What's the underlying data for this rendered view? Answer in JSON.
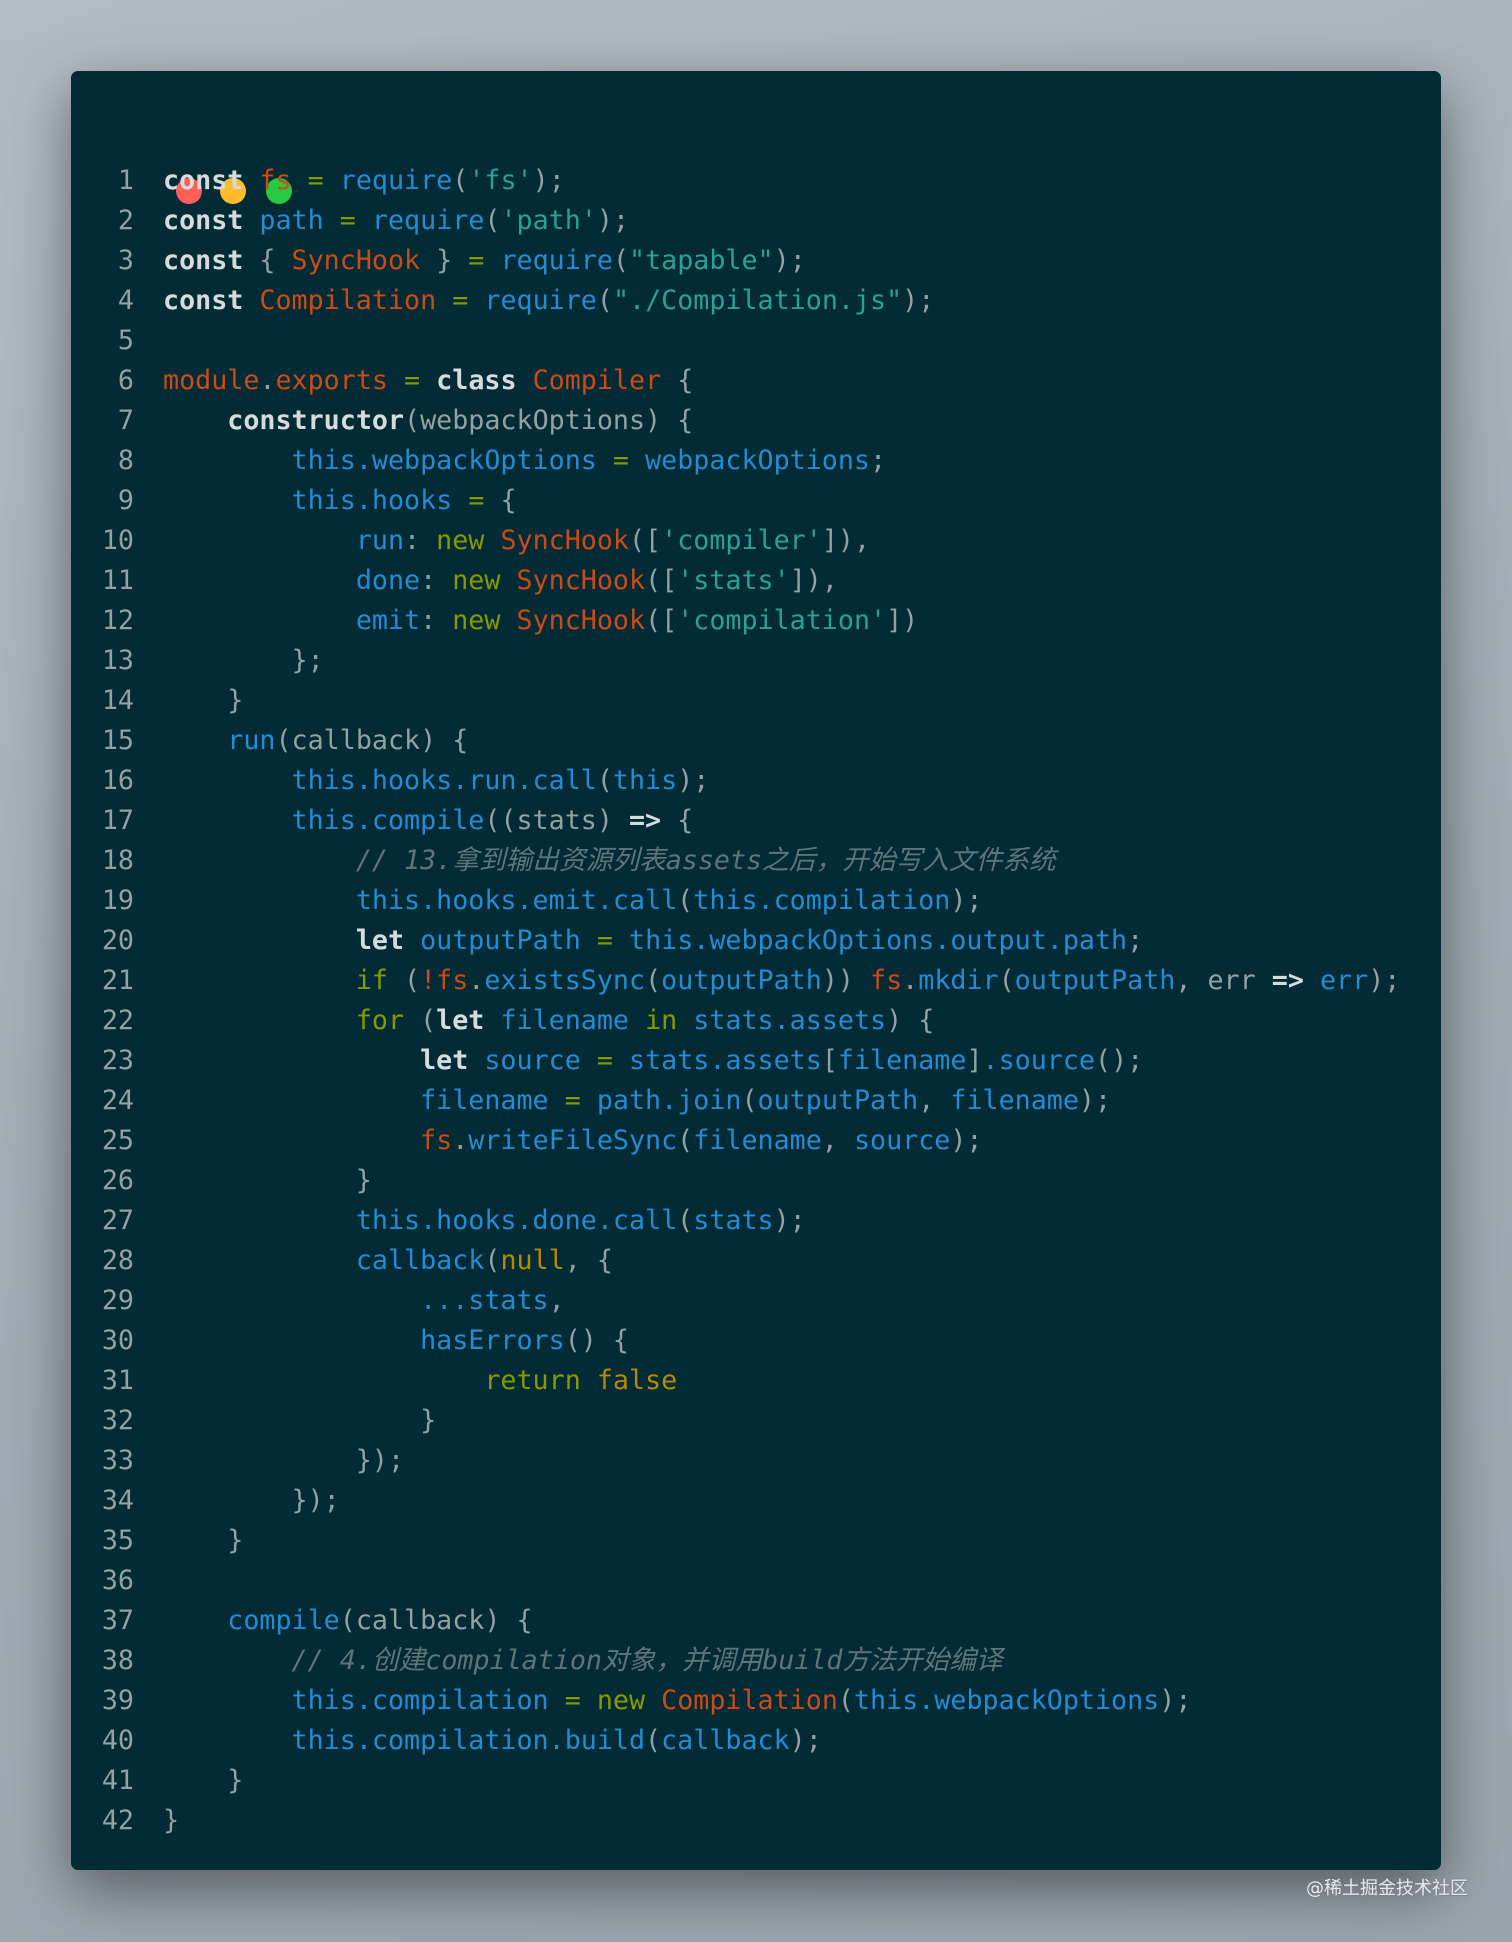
{
  "window": {
    "traffic_lights": {
      "close": "#ff5f57",
      "minimize": "#febc2e",
      "maximize": "#28c840"
    }
  },
  "watermark": "@稀土掘金技术社区",
  "code": {
    "lines": [
      [
        [
          "k",
          "const "
        ],
        [
          "o",
          "fs"
        ],
        [
          "p",
          " "
        ],
        [
          "g",
          "="
        ],
        [
          "p",
          " "
        ],
        [
          "b",
          "require"
        ],
        [
          "p",
          "("
        ],
        [
          "s",
          "'fs'"
        ],
        [
          "p",
          ");"
        ]
      ],
      [
        [
          "k",
          "const "
        ],
        [
          "b",
          "path"
        ],
        [
          "p",
          " "
        ],
        [
          "g",
          "="
        ],
        [
          "p",
          " "
        ],
        [
          "b",
          "require"
        ],
        [
          "p",
          "("
        ],
        [
          "s",
          "'path'"
        ],
        [
          "p",
          ");"
        ]
      ],
      [
        [
          "k",
          "const "
        ],
        [
          "p",
          "{ "
        ],
        [
          "o",
          "SyncHook"
        ],
        [
          "p",
          " } "
        ],
        [
          "g",
          "="
        ],
        [
          "p",
          " "
        ],
        [
          "b",
          "require"
        ],
        [
          "p",
          "("
        ],
        [
          "s",
          "\"tapable\""
        ],
        [
          "p",
          ");"
        ]
      ],
      [
        [
          "k",
          "const "
        ],
        [
          "o",
          "Compilation"
        ],
        [
          "p",
          " "
        ],
        [
          "g",
          "="
        ],
        [
          "p",
          " "
        ],
        [
          "b",
          "require"
        ],
        [
          "p",
          "("
        ],
        [
          "s",
          "\"./Compilation.js\""
        ],
        [
          "p",
          ");"
        ]
      ],
      [],
      [
        [
          "o",
          "module"
        ],
        [
          "p",
          "."
        ],
        [
          "o",
          "exports"
        ],
        [
          "p",
          " "
        ],
        [
          "g",
          "="
        ],
        [
          "p",
          " "
        ],
        [
          "k",
          "class "
        ],
        [
          "o",
          "Compiler"
        ],
        [
          "p",
          " {"
        ]
      ],
      [
        [
          "p",
          "    "
        ],
        [
          "k",
          "constructor"
        ],
        [
          "p",
          "(webpackOptions) {"
        ]
      ],
      [
        [
          "p",
          "        "
        ],
        [
          "b",
          "this.webpackOptions"
        ],
        [
          "p",
          " "
        ],
        [
          "g",
          "="
        ],
        [
          "p",
          " "
        ],
        [
          "b",
          "webpackOptions"
        ],
        [
          "p",
          ";"
        ]
      ],
      [
        [
          "p",
          "        "
        ],
        [
          "b",
          "this.hooks"
        ],
        [
          "p",
          " "
        ],
        [
          "g",
          "="
        ],
        [
          "p",
          " {"
        ]
      ],
      [
        [
          "p",
          "            "
        ],
        [
          "b",
          "run"
        ],
        [
          "p",
          ": "
        ],
        [
          "g",
          "new "
        ],
        [
          "o",
          "SyncHook"
        ],
        [
          "p",
          "(["
        ],
        [
          "s",
          "'compiler'"
        ],
        [
          "p",
          "]),"
        ]
      ],
      [
        [
          "p",
          "            "
        ],
        [
          "b",
          "done"
        ],
        [
          "p",
          ": "
        ],
        [
          "g",
          "new "
        ],
        [
          "o",
          "SyncHook"
        ],
        [
          "p",
          "(["
        ],
        [
          "s",
          "'stats'"
        ],
        [
          "p",
          "]),"
        ]
      ],
      [
        [
          "p",
          "            "
        ],
        [
          "b",
          "emit"
        ],
        [
          "p",
          ": "
        ],
        [
          "g",
          "new "
        ],
        [
          "o",
          "SyncHook"
        ],
        [
          "p",
          "(["
        ],
        [
          "s",
          "'compilation'"
        ],
        [
          "p",
          "])"
        ]
      ],
      [
        [
          "p",
          "        };"
        ]
      ],
      [
        [
          "p",
          "    }"
        ]
      ],
      [
        [
          "p",
          "    "
        ],
        [
          "b",
          "run"
        ],
        [
          "p",
          "(callback) {"
        ]
      ],
      [
        [
          "p",
          "        "
        ],
        [
          "b",
          "this.hooks.run.call"
        ],
        [
          "p",
          "("
        ],
        [
          "b",
          "this"
        ],
        [
          "p",
          ");"
        ]
      ],
      [
        [
          "p",
          "        "
        ],
        [
          "b",
          "this.compile"
        ],
        [
          "p",
          "((stats) "
        ],
        [
          "k",
          "=>"
        ],
        [
          "p",
          " {"
        ]
      ],
      [
        [
          "p",
          "            "
        ],
        [
          "c",
          "// 13.拿到输出资源列表assets之后，开始写入文件系统"
        ]
      ],
      [
        [
          "p",
          "            "
        ],
        [
          "b",
          "this.hooks.emit.call"
        ],
        [
          "p",
          "("
        ],
        [
          "b",
          "this.compilation"
        ],
        [
          "p",
          ");"
        ]
      ],
      [
        [
          "p",
          "            "
        ],
        [
          "k",
          "let "
        ],
        [
          "b",
          "outputPath"
        ],
        [
          "p",
          " "
        ],
        [
          "g",
          "="
        ],
        [
          "p",
          " "
        ],
        [
          "b",
          "this.webpackOptions.output.path"
        ],
        [
          "p",
          ";"
        ]
      ],
      [
        [
          "p",
          "            "
        ],
        [
          "g",
          "if"
        ],
        [
          "p",
          " ("
        ],
        [
          "o",
          "!fs"
        ],
        [
          "p",
          "."
        ],
        [
          "b",
          "existsSync"
        ],
        [
          "p",
          "("
        ],
        [
          "b",
          "outputPath"
        ],
        [
          "p",
          ")) "
        ],
        [
          "o",
          "fs"
        ],
        [
          "p",
          "."
        ],
        [
          "b",
          "mkdir"
        ],
        [
          "p",
          "("
        ],
        [
          "b",
          "outputPath"
        ],
        [
          "p",
          ", err "
        ],
        [
          "k",
          "=>"
        ],
        [
          "p",
          " "
        ],
        [
          "b",
          "err"
        ],
        [
          "p",
          ");"
        ]
      ],
      [
        [
          "p",
          "            "
        ],
        [
          "g",
          "for"
        ],
        [
          "p",
          " ("
        ],
        [
          "k",
          "let "
        ],
        [
          "b",
          "filename"
        ],
        [
          "p",
          " "
        ],
        [
          "g",
          "in"
        ],
        [
          "p",
          " "
        ],
        [
          "b",
          "stats.assets"
        ],
        [
          "p",
          ") {"
        ]
      ],
      [
        [
          "p",
          "                "
        ],
        [
          "k",
          "let "
        ],
        [
          "b",
          "source"
        ],
        [
          "p",
          " "
        ],
        [
          "g",
          "="
        ],
        [
          "p",
          " "
        ],
        [
          "b",
          "stats.assets"
        ],
        [
          "p",
          "["
        ],
        [
          "b",
          "filename"
        ],
        [
          "p",
          "]"
        ],
        [
          "b",
          ".source"
        ],
        [
          "p",
          "();"
        ]
      ],
      [
        [
          "p",
          "                "
        ],
        [
          "b",
          "filename"
        ],
        [
          "p",
          " "
        ],
        [
          "g",
          "="
        ],
        [
          "p",
          " "
        ],
        [
          "b",
          "path.join"
        ],
        [
          "p",
          "("
        ],
        [
          "b",
          "outputPath"
        ],
        [
          "p",
          ", "
        ],
        [
          "b",
          "filename"
        ],
        [
          "p",
          ");"
        ]
      ],
      [
        [
          "p",
          "                "
        ],
        [
          "o",
          "fs"
        ],
        [
          "p",
          "."
        ],
        [
          "b",
          "writeFileSync"
        ],
        [
          "p",
          "("
        ],
        [
          "b",
          "filename"
        ],
        [
          "p",
          ", "
        ],
        [
          "b",
          "source"
        ],
        [
          "p",
          ");"
        ]
      ],
      [
        [
          "p",
          "            }"
        ]
      ],
      [
        [
          "p",
          "            "
        ],
        [
          "b",
          "this.hooks.done.call"
        ],
        [
          "p",
          "("
        ],
        [
          "b",
          "stats"
        ],
        [
          "p",
          ");"
        ]
      ],
      [
        [
          "p",
          "            "
        ],
        [
          "b",
          "callback"
        ],
        [
          "p",
          "("
        ],
        [
          "y",
          "null"
        ],
        [
          "p",
          ", {"
        ]
      ],
      [
        [
          "p",
          "                "
        ],
        [
          "b",
          "...stats"
        ],
        [
          "p",
          ","
        ]
      ],
      [
        [
          "p",
          "                "
        ],
        [
          "b",
          "hasErrors"
        ],
        [
          "p",
          "() {"
        ]
      ],
      [
        [
          "p",
          "                    "
        ],
        [
          "g",
          "return "
        ],
        [
          "y",
          "false"
        ]
      ],
      [
        [
          "p",
          "                }"
        ]
      ],
      [
        [
          "p",
          "            });"
        ]
      ],
      [
        [
          "p",
          "        });"
        ]
      ],
      [
        [
          "p",
          "    }"
        ]
      ],
      [],
      [
        [
          "p",
          "    "
        ],
        [
          "b",
          "compile"
        ],
        [
          "p",
          "(callback) {"
        ]
      ],
      [
        [
          "p",
          "        "
        ],
        [
          "c",
          "// 4.创建compilation对象，并调用build方法开始编译"
        ]
      ],
      [
        [
          "p",
          "        "
        ],
        [
          "b",
          "this.compilation"
        ],
        [
          "p",
          " "
        ],
        [
          "g",
          "="
        ],
        [
          "p",
          " "
        ],
        [
          "g",
          "new "
        ],
        [
          "o",
          "Compilation"
        ],
        [
          "p",
          "("
        ],
        [
          "b",
          "this.webpackOptions"
        ],
        [
          "p",
          ");"
        ]
      ],
      [
        [
          "p",
          "        "
        ],
        [
          "b",
          "this.compilation.build"
        ],
        [
          "p",
          "("
        ],
        [
          "b",
          "callback"
        ],
        [
          "p",
          ");"
        ]
      ],
      [
        [
          "p",
          "    }"
        ]
      ],
      [
        [
          "p",
          "}"
        ]
      ]
    ]
  }
}
